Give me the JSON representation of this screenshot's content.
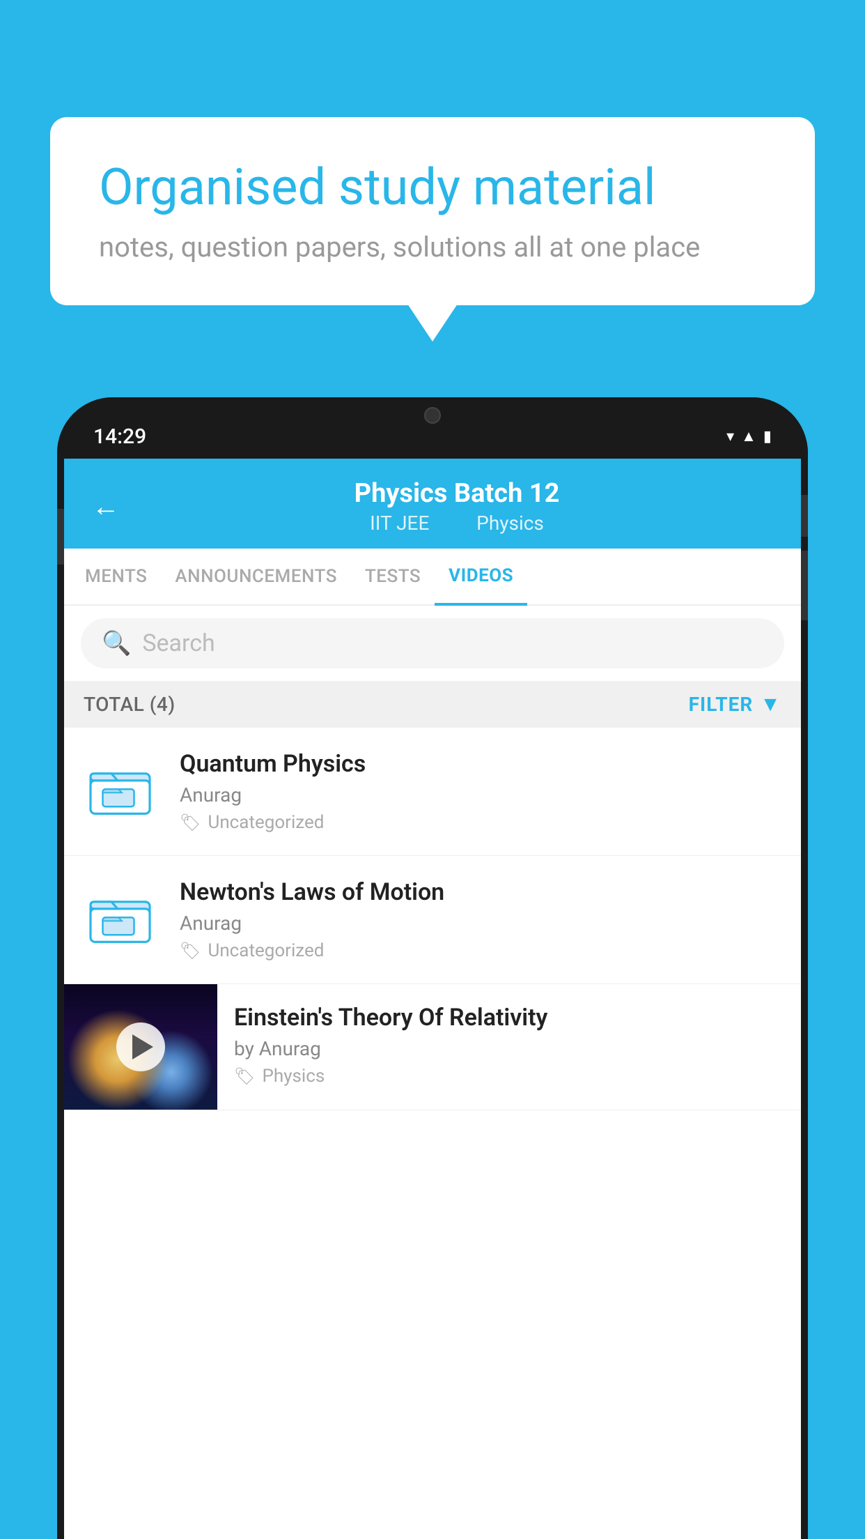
{
  "background_color": "#29b6e8",
  "speech_bubble": {
    "title": "Organised study material",
    "subtitle": "notes, question papers, solutions all at one place"
  },
  "phone": {
    "time": "14:29",
    "header": {
      "title": "Physics Batch 12",
      "subtitle_left": "IIT JEE",
      "subtitle_right": "Physics"
    },
    "tabs": [
      {
        "label": "MENTS",
        "active": false
      },
      {
        "label": "ANNOUNCEMENTS",
        "active": false
      },
      {
        "label": "TESTS",
        "active": false
      },
      {
        "label": "VIDEOS",
        "active": true
      }
    ],
    "search": {
      "placeholder": "Search"
    },
    "filter": {
      "total_label": "TOTAL (4)",
      "button_label": "FILTER"
    },
    "videos": [
      {
        "id": 1,
        "title": "Quantum Physics",
        "author": "Anurag",
        "tag": "Uncategorized",
        "type": "folder"
      },
      {
        "id": 2,
        "title": "Newton's Laws of Motion",
        "author": "Anurag",
        "tag": "Uncategorized",
        "type": "folder"
      },
      {
        "id": 3,
        "title": "Einstein's Theory Of Relativity",
        "author": "by Anurag",
        "tag": "Physics",
        "type": "video"
      }
    ]
  }
}
